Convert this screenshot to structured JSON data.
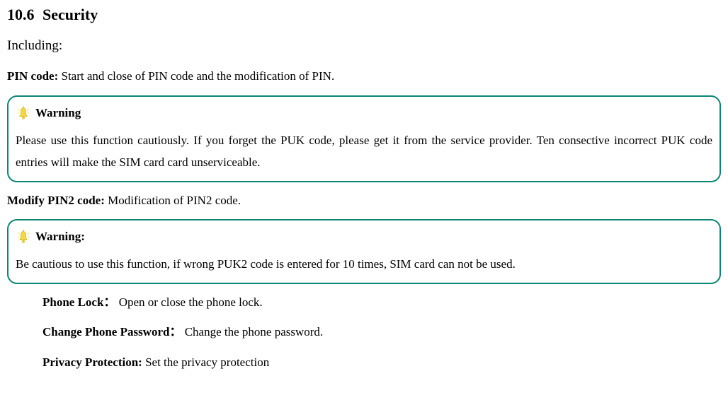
{
  "heading": {
    "number": "10.6",
    "title": "Security"
  },
  "intro": "Including:",
  "pin_code": {
    "label": "PIN code:",
    "text": " Start and close of PIN code and the modification of PIN."
  },
  "warning1": {
    "label": "Warning",
    "body": "Please use this function cautiously. If you forget the PUK code, please get it from the service provider. Ten consective incorrect PUK code entries will make the SIM card card unserviceable."
  },
  "modify_pin2": {
    "label": "Modify PIN2 code:",
    "text": " Modification of PIN2 code."
  },
  "warning2": {
    "label": "Warning:",
    "body": "Be cautious to use this function, if wrong PUK2 code is entered for 10 times, SIM card can not be used."
  },
  "items": [
    {
      "label": "Phone Lock：",
      "text": " Open or close the phone lock."
    },
    {
      "label": "Change Phone Password：",
      "text": " Change the phone password."
    },
    {
      "label": "Privacy Protection:",
      "text": " Set the privacy protection"
    }
  ]
}
